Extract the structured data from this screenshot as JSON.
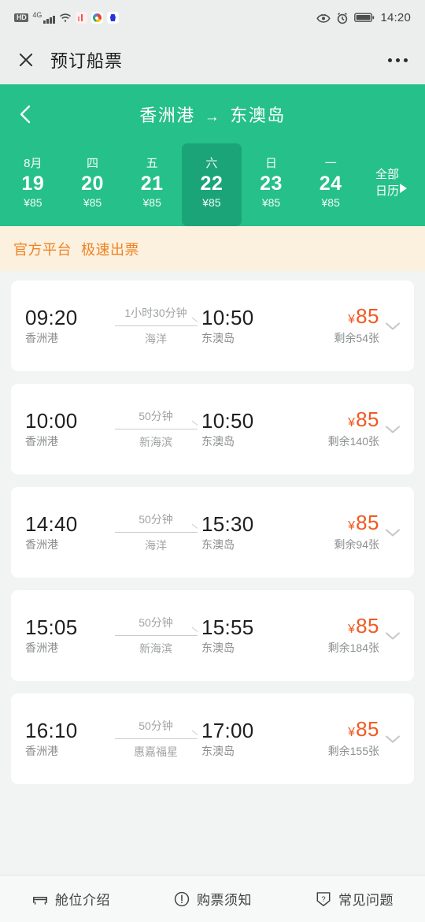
{
  "status_bar": {
    "hd_badge": "HD",
    "network_type": "4G",
    "icons": [
      "hd-badge",
      "signal-bars",
      "wifi",
      "chart-app-icon",
      "chrome-app-icon",
      "baidu-app-icon",
      "eye-care-icon",
      "alarm-clock-icon",
      "battery-icon"
    ],
    "time": "14:20"
  },
  "titlebar": {
    "close_icon": "close-icon",
    "title": "预订船票",
    "more_icon": "more-options-icon"
  },
  "header": {
    "back_icon": "back-chevron-icon",
    "origin": "香洲港",
    "arrow": "→",
    "destination": "东澳岛",
    "bg_color": "#26c08a",
    "selected_bg_color": "#1ba478",
    "dates": [
      {
        "week": "8月",
        "day": "19",
        "price": "¥85",
        "selected": false
      },
      {
        "week": "四",
        "day": "20",
        "price": "¥85",
        "selected": false
      },
      {
        "week": "五",
        "day": "21",
        "price": "¥85",
        "selected": false
      },
      {
        "week": "六",
        "day": "22",
        "price": "¥85",
        "selected": true
      },
      {
        "week": "日",
        "day": "23",
        "price": "¥85",
        "selected": false
      },
      {
        "week": "一",
        "day": "24",
        "price": "¥85",
        "selected": false
      }
    ],
    "all_calendar": {
      "line1": "全部",
      "line2": "日历",
      "caret_icon": "caret-right-icon"
    }
  },
  "promo": {
    "tag1": "官方平台",
    "tag2": "极速出票",
    "text_color": "#ee8124",
    "bg_color": "#fcf1de"
  },
  "schedules": [
    {
      "depart_time": "09:20",
      "depart_port": "香洲港",
      "duration": "1小时30分钟",
      "ship": "海洋",
      "arrive_time": "10:50",
      "arrive_port": "东澳岛",
      "currency": "¥",
      "price": "85",
      "seats_left": "剩余54张",
      "expand_icon": "chevron-down-icon"
    },
    {
      "depart_time": "10:00",
      "depart_port": "香洲港",
      "duration": "50分钟",
      "ship": "新海滨",
      "arrive_time": "10:50",
      "arrive_port": "东澳岛",
      "currency": "¥",
      "price": "85",
      "seats_left": "剩余140张",
      "expand_icon": "chevron-down-icon"
    },
    {
      "depart_time": "14:40",
      "depart_port": "香洲港",
      "duration": "50分钟",
      "ship": "海洋",
      "arrive_time": "15:30",
      "arrive_port": "东澳岛",
      "currency": "¥",
      "price": "85",
      "seats_left": "剩余94张",
      "expand_icon": "chevron-down-icon"
    },
    {
      "depart_time": "15:05",
      "depart_port": "香洲港",
      "duration": "50分钟",
      "ship": "新海滨",
      "arrive_time": "15:55",
      "arrive_port": "东澳岛",
      "currency": "¥",
      "price": "85",
      "seats_left": "剩余184张",
      "expand_icon": "chevron-down-icon"
    },
    {
      "depart_time": "16:10",
      "depart_port": "香洲港",
      "duration": "50分钟",
      "ship": "惠嘉福星",
      "arrive_time": "17:00",
      "arrive_port": "东澳岛",
      "currency": "¥",
      "price": "85",
      "seats_left": "剩余155张",
      "expand_icon": "chevron-down-icon"
    }
  ],
  "footer": [
    {
      "icon": "seat-icon",
      "label": "舱位介绍"
    },
    {
      "icon": "exclamation-circle-icon",
      "label": "购票须知"
    },
    {
      "icon": "question-shield-icon",
      "label": "常见问题"
    }
  ],
  "colors": {
    "accent_green": "#26c08a",
    "accent_green_dark": "#1ba478",
    "price_orange": "#f05a23",
    "promo_orange": "#ee8124",
    "page_bg": "#f2f4f3"
  }
}
